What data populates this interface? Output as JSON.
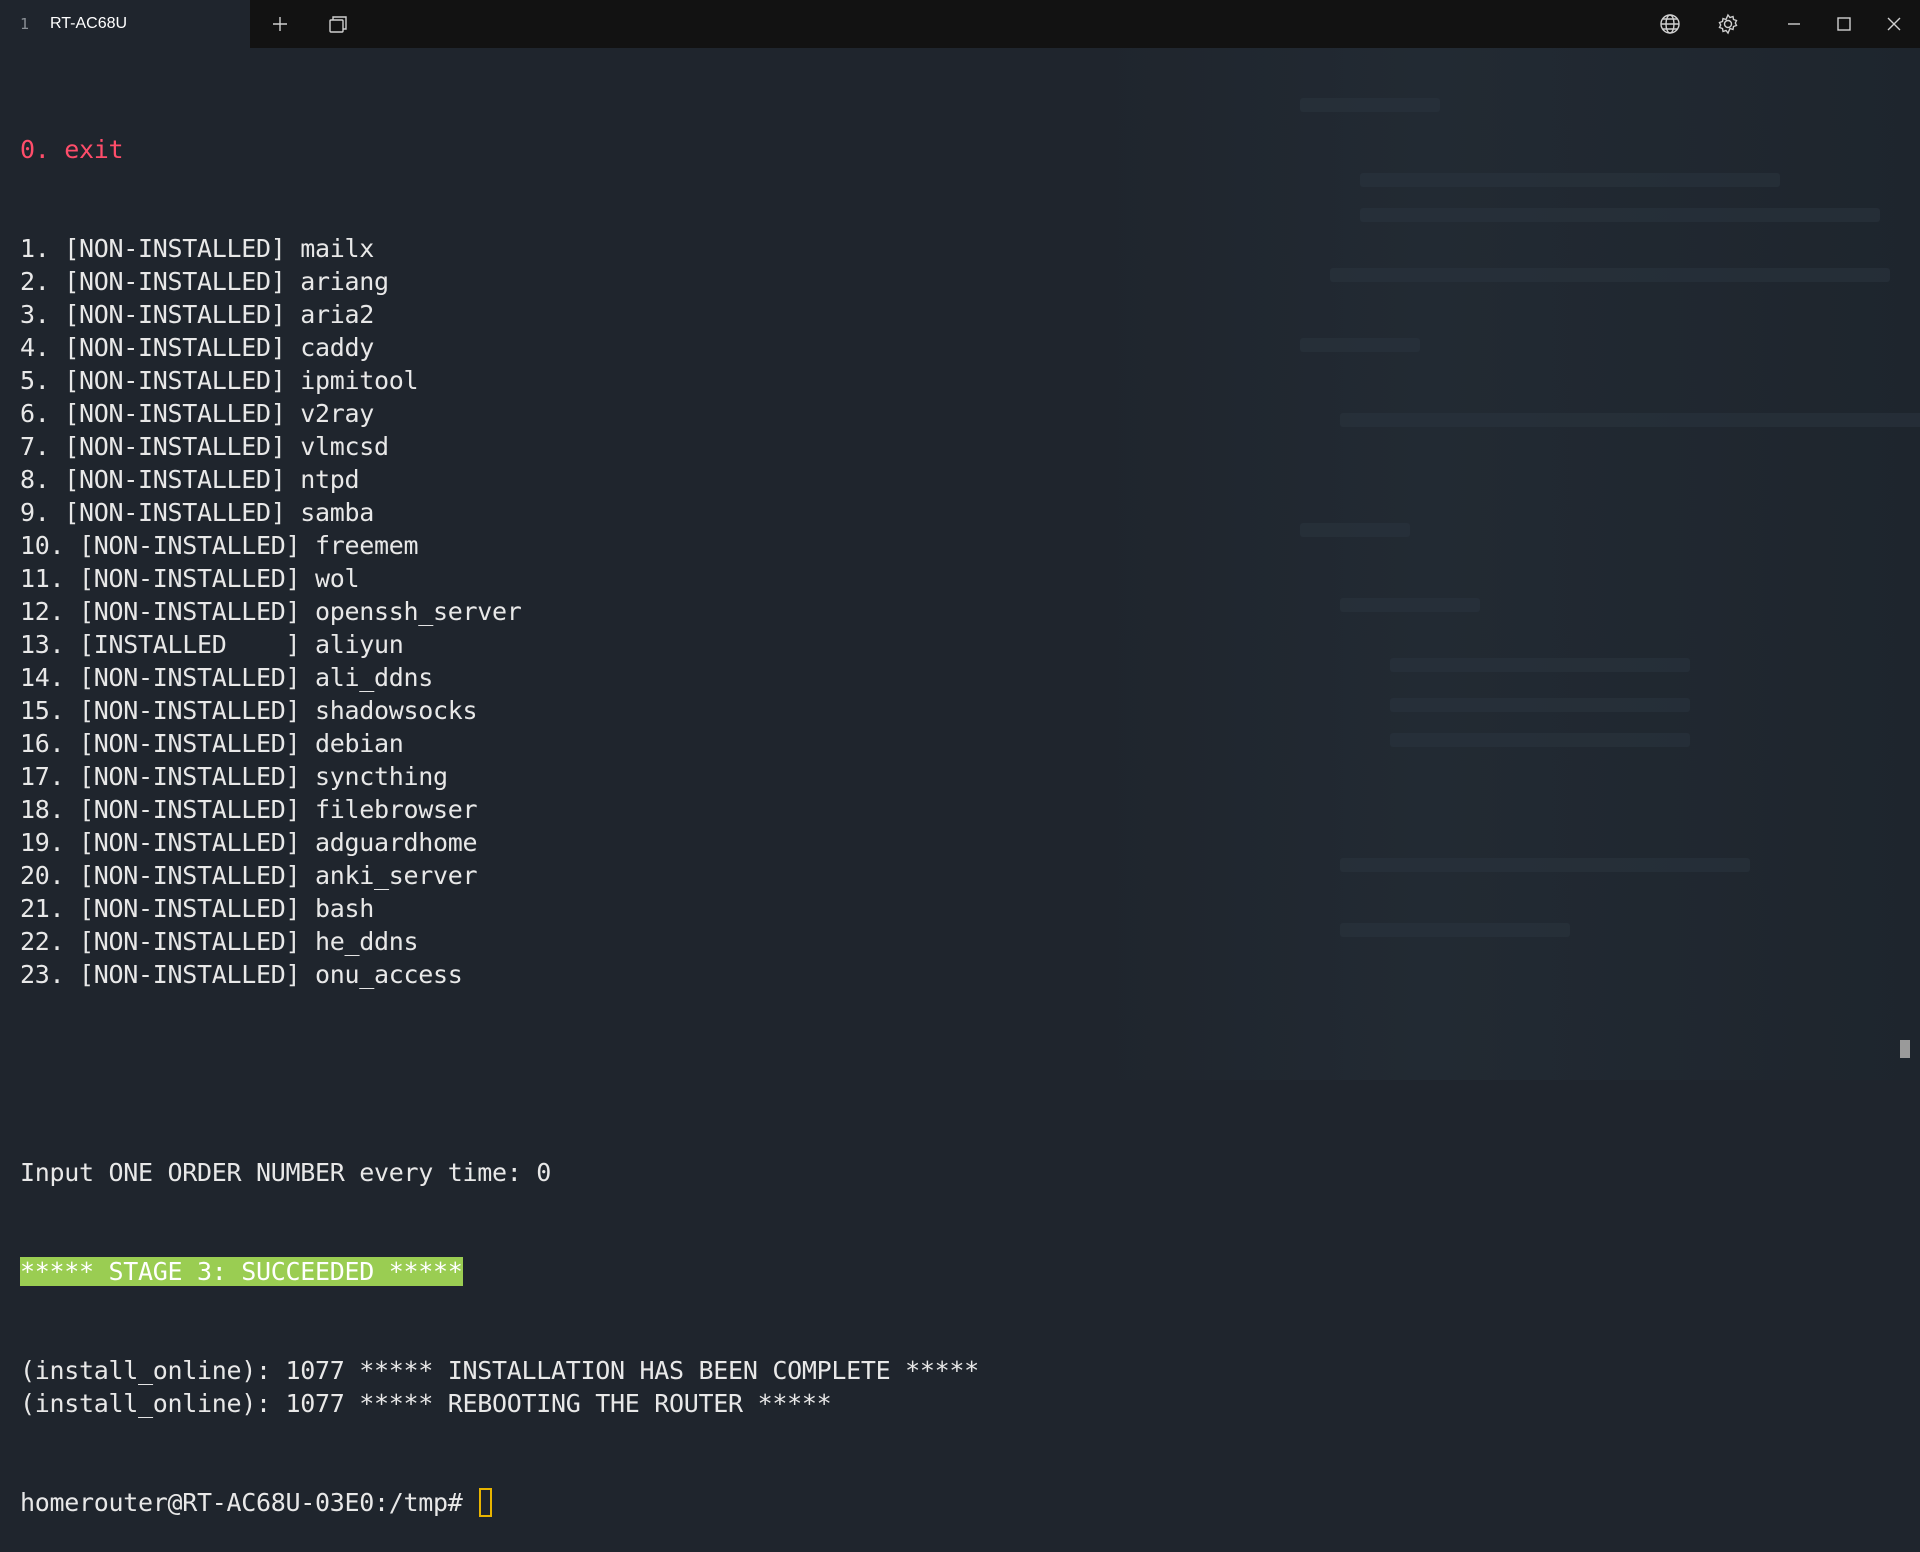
{
  "window": {
    "tab_number": "1",
    "tab_title": "RT-AC68U"
  },
  "terminal": {
    "exit_line": "0. exit",
    "menu_items": [
      "1. [NON-INSTALLED] mailx",
      "2. [NON-INSTALLED] ariang",
      "3. [NON-INSTALLED] aria2",
      "4. [NON-INSTALLED] caddy",
      "5. [NON-INSTALLED] ipmitool",
      "6. [NON-INSTALLED] v2ray",
      "7. [NON-INSTALLED] vlmcsd",
      "8. [NON-INSTALLED] ntpd",
      "9. [NON-INSTALLED] samba",
      "10. [NON-INSTALLED] freemem",
      "11. [NON-INSTALLED] wol",
      "12. [NON-INSTALLED] openssh_server",
      "13. [INSTALLED    ] aliyun",
      "14. [NON-INSTALLED] ali_ddns",
      "15. [NON-INSTALLED] shadowsocks",
      "16. [NON-INSTALLED] debian",
      "17. [NON-INSTALLED] syncthing",
      "18. [NON-INSTALLED] filebrowser",
      "19. [NON-INSTALLED] adguardhome",
      "20. [NON-INSTALLED] anki_server",
      "21. [NON-INSTALLED] bash",
      "22. [NON-INSTALLED] he_ddns",
      "23. [NON-INSTALLED] onu_access"
    ],
    "input_prompt": "Input ONE ORDER NUMBER every time: 0",
    "stage_banner": "***** STAGE 3: SUCCEEDED *****",
    "log_lines": [
      "(install_online): 1077 ***** INSTALLATION HAS BEEN COMPLETE *****",
      "(install_online): 1077 ***** REBOOTING THE ROUTER *****"
    ],
    "shell_prompt": "homerouter@RT-AC68U-03E0:/tmp# "
  },
  "colors": {
    "exit": "#ff4d6a",
    "success_bg": "#9acd52",
    "cursor": "#e8b400"
  }
}
